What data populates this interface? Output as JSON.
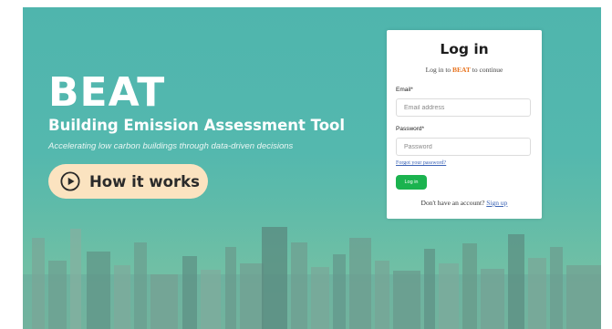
{
  "hero": {
    "brand": "BEAT",
    "subtitle": "Building Emission Assessment Tool",
    "tagline": "Accelerating low carbon buildings through data-driven decisions",
    "how_it_works_label": "How it works"
  },
  "login": {
    "title": "Log in",
    "subtitle_prefix": "Log in to",
    "subtitle_brand": "BEAT",
    "subtitle_suffix": "to continue",
    "email_label": "Email*",
    "email_placeholder": "Email address",
    "password_label": "Password*",
    "password_placeholder": "Password",
    "forgot_label": "Forgot your password?",
    "login_button": "Log in",
    "no_account_text": "Don't have an account?",
    "signup_label": "Sign up"
  },
  "colors": {
    "hero_teal": "#54b8ae",
    "button_cream": "#fbe3c0",
    "brand_accent": "#e8731f",
    "login_green": "#1bb34f",
    "link_blue": "#3b63b5"
  },
  "icons": {
    "how_it_works": "play-circle-icon"
  }
}
